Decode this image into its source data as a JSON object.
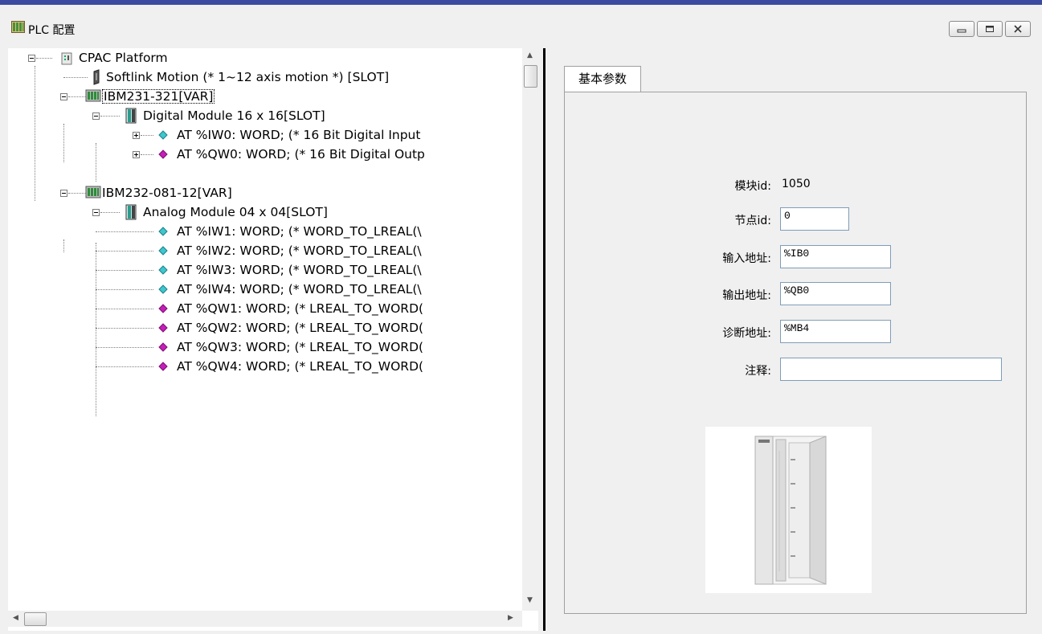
{
  "window": {
    "title": "PLC 配置"
  },
  "tree": {
    "nodes": [
      {
        "label": "CPAC Platform"
      },
      {
        "label": "Softlink Motion (* 1~12 axis motion *) [SLOT]"
      },
      {
        "label": "IBM231-321[VAR]"
      },
      {
        "label": "Digital Module 16 x 16[SLOT]"
      },
      {
        "label": "AT %IW0: WORD; (* 16 Bit Digital Input"
      },
      {
        "label": "AT %QW0: WORD; (* 16 Bit Digital Outp"
      },
      {
        "label": "IBM232-081-12[VAR]"
      },
      {
        "label": "Analog Module 04 x 04[SLOT]"
      },
      {
        "label": "AT %IW1: WORD; (* WORD_TO_LREAL(\\"
      },
      {
        "label": "AT %IW2: WORD; (* WORD_TO_LREAL(\\"
      },
      {
        "label": "AT %IW3: WORD; (* WORD_TO_LREAL(\\"
      },
      {
        "label": "AT %IW4: WORD; (* WORD_TO_LREAL(\\"
      },
      {
        "label": "AT %QW1: WORD; (* LREAL_TO_WORD("
      },
      {
        "label": "AT %QW2: WORD; (* LREAL_TO_WORD("
      },
      {
        "label": "AT %QW3: WORD; (* LREAL_TO_WORD("
      },
      {
        "label": "AT %QW4: WORD; (* LREAL_TO_WORD("
      }
    ]
  },
  "props": {
    "tab": "基本参数",
    "module_id_label": "模块id:",
    "module_id_value": "1050",
    "node_id_label": "节点id:",
    "node_id_value": "0",
    "input_addr_label": "输入地址:",
    "input_addr_value": "%IB0",
    "output_addr_label": "输出地址:",
    "output_addr_value": "%QB0",
    "diag_addr_label": "诊断地址:",
    "diag_addr_value": "%MB4",
    "comment_label": "注释:",
    "comment_value": ""
  },
  "colors": {
    "input_var": "#3fc6cf",
    "output_var": "#c41fb8",
    "topbar": "#3a4ba0"
  }
}
